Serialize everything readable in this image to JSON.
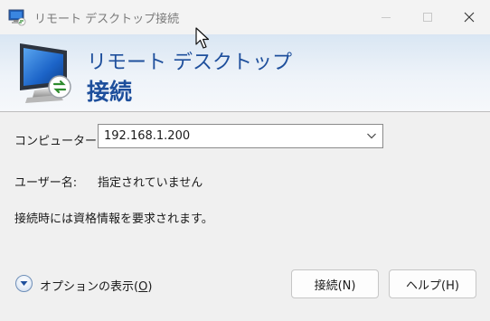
{
  "titlebar": {
    "title": "リモート デスクトップ接続",
    "close_glyph": "✕"
  },
  "banner": {
    "line1": "リモート デスクトップ",
    "line2": "接続"
  },
  "form": {
    "computer_label": "コンピューター(C):",
    "computer_value": "192.168.1.200",
    "username_label": "ユーザー名:",
    "username_value": "指定されていません",
    "info_text": "接続時には資格情報を要求されます。"
  },
  "footer": {
    "options_label_prefix": "オプションの表示(",
    "options_label_key": "O",
    "options_label_suffix": ")",
    "connect_label": "接続(N)",
    "help_label": "ヘルプ(H)"
  },
  "colors": {
    "accent": "#1e4f9c",
    "banner_top": "#d9e6f3"
  },
  "icons": [
    "rdp-app-icon",
    "minimize-icon",
    "maximize-icon",
    "close-icon",
    "remote-desktop-monitor-icon",
    "chevron-down-icon",
    "expand-options-icon",
    "mouse-cursor-icon"
  ]
}
